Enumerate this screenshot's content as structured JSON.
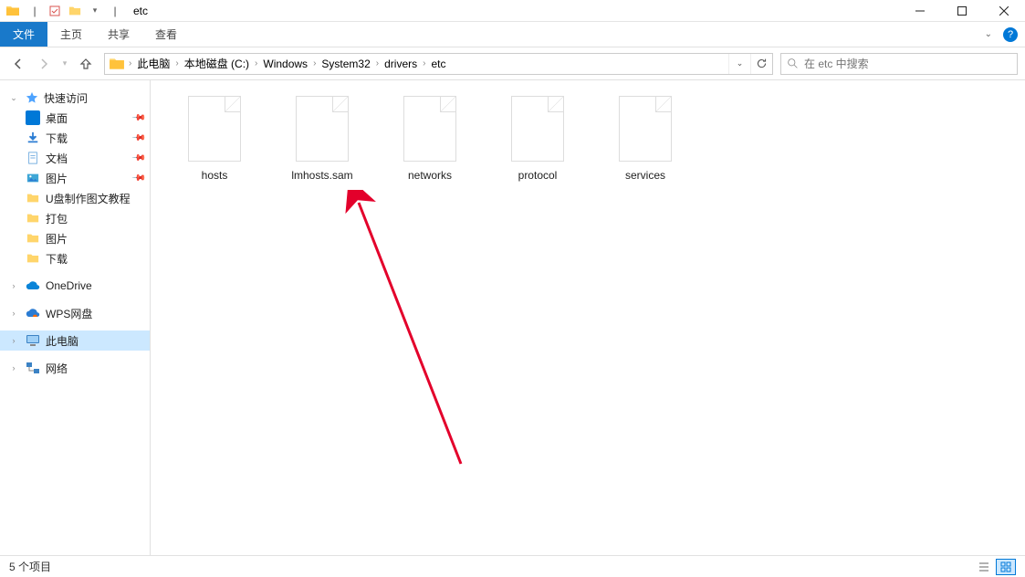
{
  "window": {
    "title": "etc"
  },
  "menu": {
    "file": "文件",
    "items": [
      "主页",
      "共享",
      "查看"
    ]
  },
  "nav": {
    "breadcrumbs": [
      "此电脑",
      "本地磁盘 (C:)",
      "Windows",
      "System32",
      "drivers",
      "etc"
    ]
  },
  "search": {
    "placeholder": "在 etc 中搜索"
  },
  "tree": {
    "quick_access": "快速访问",
    "quick_items": [
      "桌面",
      "下载",
      "文档",
      "图片",
      "U盘制作图文教程",
      "打包",
      "图片",
      "下载"
    ],
    "onedrive": "OneDrive",
    "wps": "WPS网盘",
    "this_pc": "此电脑",
    "network": "网络"
  },
  "files": [
    "hosts",
    "lmhosts.sam",
    "networks",
    "protocol",
    "services"
  ],
  "status": {
    "count": "5 个项目"
  }
}
